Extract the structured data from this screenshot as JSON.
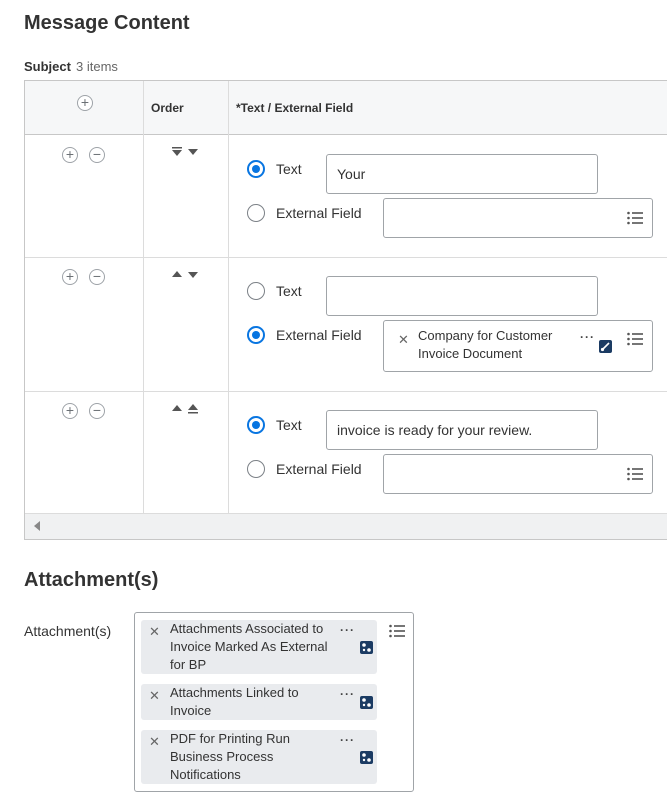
{
  "message_content": {
    "title": "Message Content",
    "subject_label": "Subject",
    "subject_count": "3 items",
    "columns": {
      "order": "Order",
      "text_field": "*Text / External Field"
    },
    "rows": [
      {
        "text_label": "Text",
        "external_label": "External Field",
        "selected": "text",
        "text_value": "Your",
        "external_values": []
      },
      {
        "text_label": "Text",
        "external_label": "External Field",
        "selected": "external",
        "text_value": "",
        "external_values": [
          "Company for Customer Invoice Document"
        ]
      },
      {
        "text_label": "Text",
        "external_label": "External Field",
        "selected": "text",
        "text_value": "invoice is ready for your review.",
        "external_values": []
      }
    ]
  },
  "attachments": {
    "title": "Attachment(s)",
    "label": "Attachment(s)",
    "items": [
      "Attachments Associated to Invoice Marked As External for BP",
      "Attachments Linked to Invoice",
      "PDF for Printing Run Business Process Notifications"
    ]
  },
  "icons": {
    "add": "plus-circle-icon",
    "remove": "minus-circle-icon",
    "move_top": "move-to-top-icon",
    "move_down": "move-down-icon",
    "move_up": "move-up-icon",
    "move_bottom": "move-to-bottom-icon",
    "prompt_list": "list-icon",
    "related_actions": "ellipsis-icon",
    "instance_badge": "related-actions-badge-icon",
    "remove_item": "close-icon",
    "scroll_left": "scroll-left-icon"
  },
  "colors": {
    "accent": "#0875e1",
    "badge": "#1b3b63",
    "pill": "#e9ebee"
  }
}
